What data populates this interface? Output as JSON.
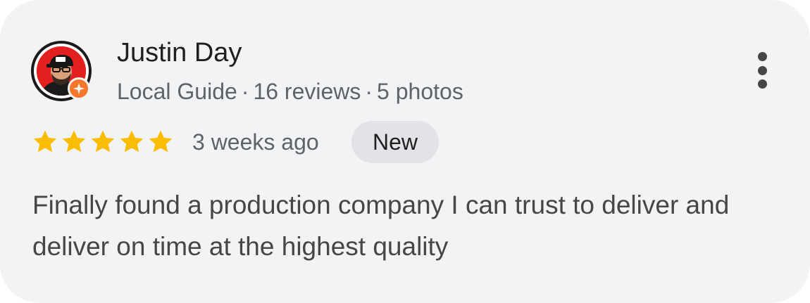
{
  "review": {
    "reviewer_name": "Justin Day",
    "reviewer_level": "Local Guide",
    "reviews_count": "16 reviews",
    "photos_count": "5 photos",
    "separator": "·",
    "rating": 5,
    "rating_max": 5,
    "time_ago": "3 weeks ago",
    "badge": "New",
    "text": "Finally found a production company I can trust to deliver and deliver on time at the highest quality"
  },
  "colors": {
    "card_background": "#f2f3f5",
    "star": "#fbbc04",
    "guide_badge": "#f4772c",
    "new_badge_background": "#e1e3e6"
  },
  "icons": {
    "more": "more-vert-icon",
    "guide": "local-guide-badge-icon",
    "star": "star-icon"
  }
}
